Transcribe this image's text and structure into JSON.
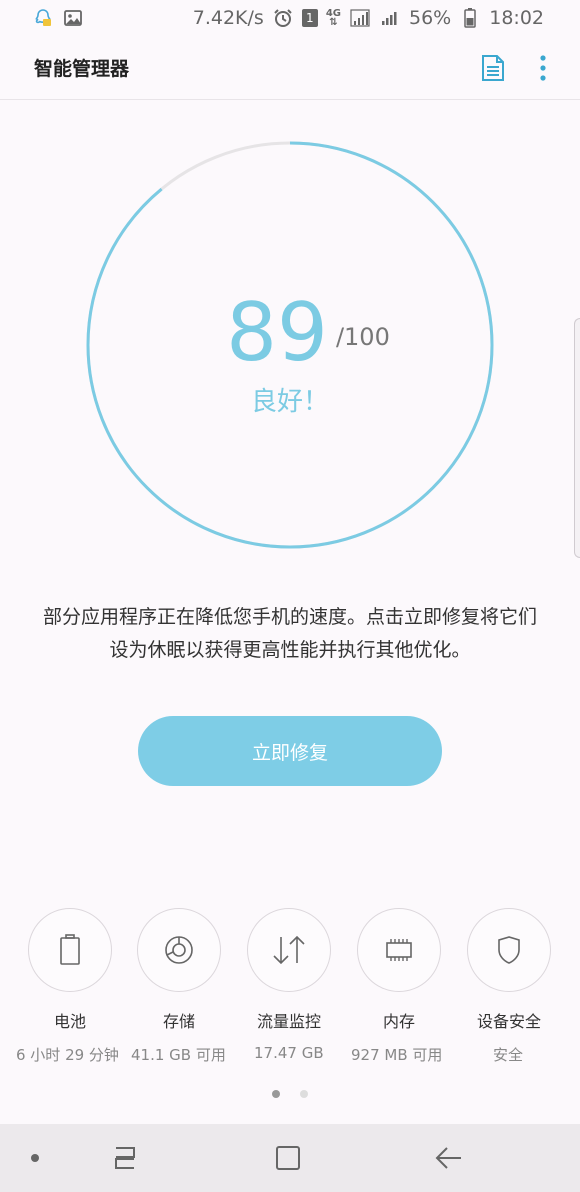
{
  "status_bar": {
    "speed": "7.42K/s",
    "sim_badge": "1",
    "network": "4G",
    "battery": "56%",
    "time": "18:02"
  },
  "app_bar": {
    "title": "智能管理器"
  },
  "score": {
    "value": "89",
    "total": "/100",
    "status": "良好！",
    "fraction": 0.89
  },
  "description": "部分应用程序正在降低您手机的速度。点击立即修复将它们设为休眠以获得更高性能并执行其他优化。",
  "fix_button": "立即修复",
  "features": [
    {
      "label": "电池",
      "value": "6 小时 29 分钟"
    },
    {
      "label": "存储",
      "value": "41.1 GB 可用"
    },
    {
      "label": "流量监控",
      "value": "17.47 GB"
    },
    {
      "label": "内存",
      "value": "927 MB 可用"
    },
    {
      "label": "设备安全",
      "value": "安全"
    }
  ],
  "colors": {
    "accent": "#7ccbe3",
    "button": "#7ecde6",
    "track": "#e6e4e6"
  }
}
